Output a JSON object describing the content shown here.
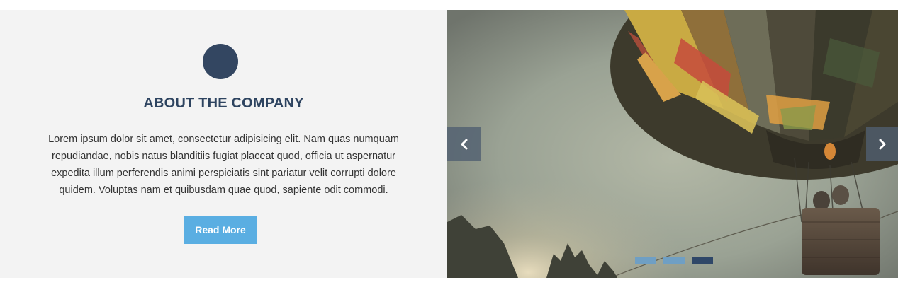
{
  "about": {
    "icon": "circle-icon",
    "title": "ABOUT THE COMPANY",
    "text": "Lorem ipsum dolor sit amet, consectetur adipisicing elit. Nam quas numquam repudiandae, nobis natus blanditiis fugiat placeat quod, officia ut aspernatur expedita illum perferendis animi perspiciatis sint pariatur velit corrupti dolore quidem. Voluptas nam et quibusdam quae quod, sapiente odit commodi.",
    "button_label": "Read More"
  },
  "slider": {
    "prev_icon": "chevron-left-icon",
    "next_icon": "chevron-right-icon",
    "slide_count": 3,
    "active_slide": 3
  },
  "colors": {
    "accent": "#5aaee2",
    "navy": "#334661",
    "panel_bg": "#f3f3f3"
  }
}
